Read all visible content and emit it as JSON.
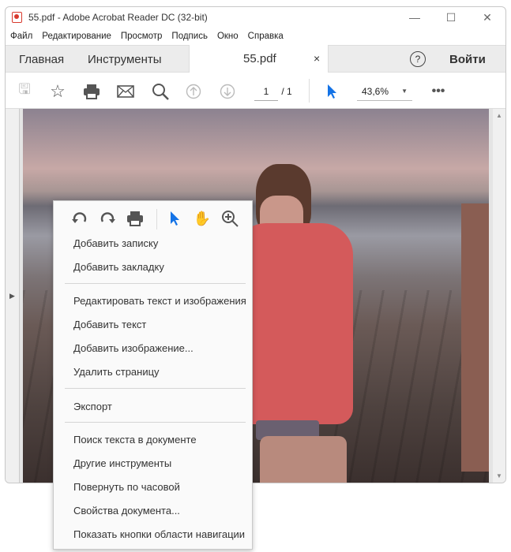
{
  "window": {
    "title": "55.pdf - Adobe Acrobat Reader DC (32-bit)"
  },
  "menubar": [
    "Файл",
    "Редактирование",
    "Просмотр",
    "Подпись",
    "Окно",
    "Справка"
  ],
  "tabs": {
    "home": "Главная",
    "tools": "Инструменты",
    "document": "55.pdf",
    "close": "×",
    "signin": "Войти"
  },
  "toolbar": {
    "page_current": "1",
    "page_total": "/ 1",
    "zoom": "43,6%"
  },
  "context_menu": {
    "items": [
      "Добавить записку",
      "Добавить закладку",
      "Редактировать текст и изображения",
      "Добавить текст",
      "Добавить изображение...",
      "Удалить страницу",
      "Экспорт",
      "Поиск текста в документе",
      "Другие инструменты",
      "Повернуть по часовой",
      "Свойства документа...",
      "Показать кнопки области навигации"
    ]
  },
  "colors": {
    "accent": "#1473e6",
    "pdf_red": "#d83a2e"
  }
}
